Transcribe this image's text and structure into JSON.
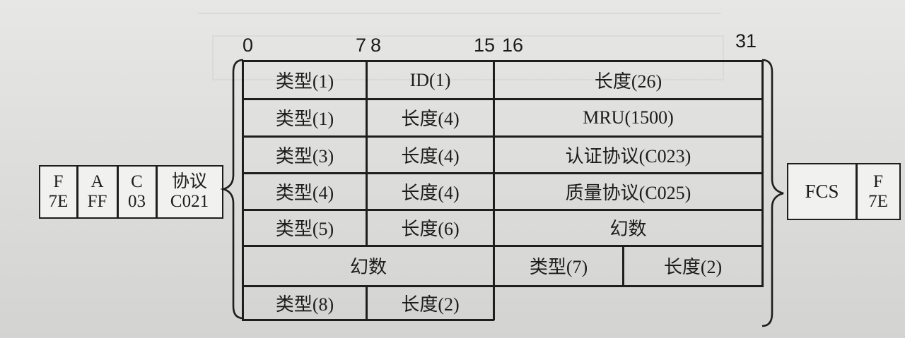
{
  "axis": {
    "a0": "0",
    "a7": "7",
    "a8": "8",
    "a15": "15",
    "a16": "16",
    "a31": "31"
  },
  "header": {
    "f": {
      "top": "F",
      "bottom": "7E"
    },
    "a": {
      "top": "A",
      "bottom": "FF"
    },
    "c": {
      "top": "C",
      "bottom": "03"
    },
    "protocol": {
      "top": "协议",
      "bottom": "C021"
    }
  },
  "trailer": {
    "fcs": "FCS",
    "f": {
      "top": "F",
      "bottom": "7E"
    }
  },
  "options": {
    "r1": {
      "type": "类型(1)",
      "id": "ID(1)",
      "length": "长度(26)"
    },
    "r2": {
      "type": "类型(1)",
      "length": "长度(4)",
      "value": "MRU(1500)"
    },
    "r3": {
      "type": "类型(3)",
      "length": "长度(4)",
      "value": "认证协议(C023)"
    },
    "r4": {
      "type": "类型(4)",
      "length": "长度(4)",
      "value": "质量协议(C025)"
    },
    "r5": {
      "type": "类型(5)",
      "length": "长度(6)",
      "value": "幻数"
    },
    "r6": {
      "value": "幻数",
      "type": "类型(7)",
      "length": "长度(2)"
    },
    "r7": {
      "type": "类型(8)",
      "length": "长度(2)"
    }
  }
}
